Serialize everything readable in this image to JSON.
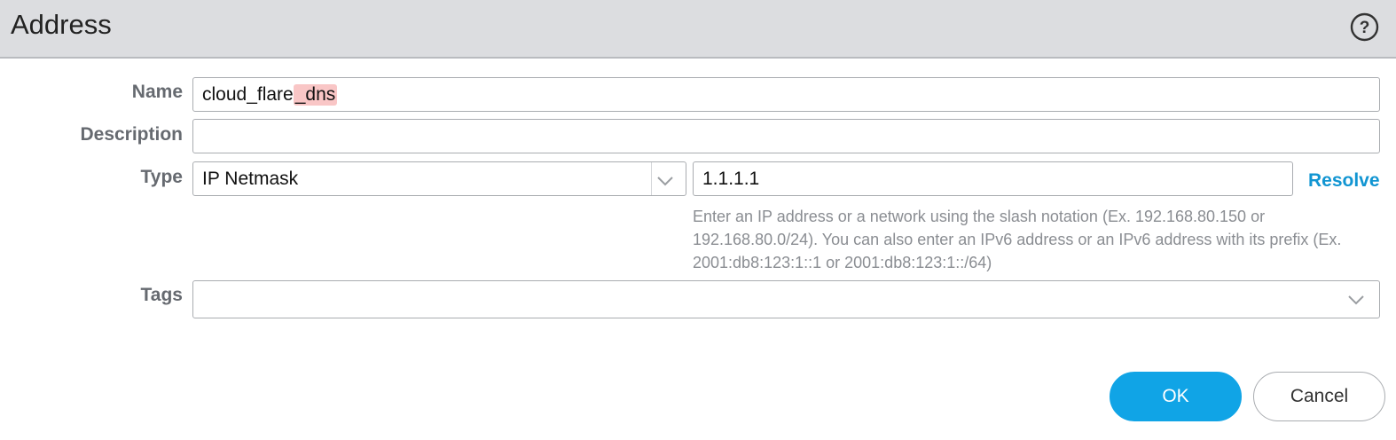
{
  "dialog": {
    "title": "Address",
    "help_icon": "question-circle-icon"
  },
  "form": {
    "name": {
      "label": "Name",
      "value_plain": "cloud_flare",
      "value_highlighted": "_dns"
    },
    "description": {
      "label": "Description",
      "value": ""
    },
    "type": {
      "label": "Type",
      "selected": "IP Netmask",
      "dropdown_icon": "chevron-down-icon",
      "address_value": "1.1.1.1",
      "resolve_label": "Resolve",
      "hint": "Enter an IP address or a network using the slash notation (Ex. 192.168.80.150 or 192.168.80.0/24). You can also enter an IPv6 address or an IPv6 address with its prefix (Ex. 2001:db8:123:1::1 or 2001:db8:123:1::/64)"
    },
    "tags": {
      "label": "Tags",
      "value": "",
      "dropdown_icon": "chevron-down-icon"
    }
  },
  "buttons": {
    "ok_label": "OK",
    "cancel_label": "Cancel"
  },
  "colors": {
    "header_bg": "#dcdde0",
    "accent": "#10a4e6",
    "link": "#1195d2",
    "highlight": "#f9c6c6"
  }
}
